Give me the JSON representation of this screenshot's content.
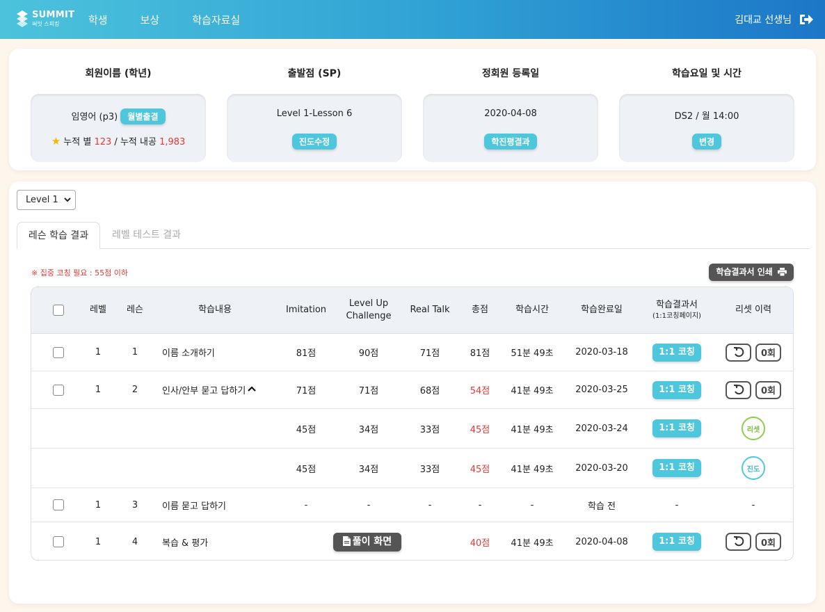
{
  "header": {
    "logo_title": "SUMMIT",
    "logo_sub": "써밋 스피킹",
    "nav": [
      "학생",
      "보상",
      "학습자료실"
    ],
    "user_name": "김대교 선생님"
  },
  "info": {
    "member": {
      "title": "회원이름 (학년)",
      "name": "임영어 (p3)",
      "button": "월별출결",
      "stars_label": "누적 별",
      "stars": "123",
      "sep": "/",
      "points_label": "누적 내공",
      "points": "1,983"
    },
    "start": {
      "title": "출발점 (SP)",
      "value": "Level 1-Lesson 6",
      "button": "진도수정"
    },
    "regdate": {
      "title": "정회원 등록일",
      "value": "2020-04-08",
      "button": "학진평결과"
    },
    "schedule": {
      "title": "학습요일 및 시간",
      "value": "DS2 / 월 14:00",
      "button": "변경"
    }
  },
  "level_select": {
    "value": "Level 1"
  },
  "tabs": [
    "레슨 학습 결과",
    "레벨 테스트 결과"
  ],
  "note": "※ 집중 코칭 필요 : 55점 이하",
  "print_button": "학습결과서 인쇄",
  "table": {
    "headers": {
      "level": "레벨",
      "lesson": "레슨",
      "content": "학습내용",
      "imitation": "Imitation",
      "levelup1": "Level Up",
      "levelup2": "Challenge",
      "realtalk": "Real Talk",
      "total": "총점",
      "time": "학습시간",
      "date": "학습완료일",
      "report1": "학습결과서",
      "report2": "(1:1코칭페이지)",
      "reset": "리셋 이력"
    },
    "coach_label": "1:1 코칭",
    "rows": [
      {
        "level": "1",
        "lesson": "1",
        "content": "이름 소개하기",
        "imitation": "81점",
        "levelup": "90점",
        "realtalk": "71점",
        "total": "81점",
        "time": "51분 49초",
        "date": "2020-03-18",
        "count": "0회"
      },
      {
        "level": "1",
        "lesson": "2",
        "content": "인사/안부 묻고 답하기",
        "imitation": "71점",
        "levelup": "71점",
        "realtalk": "68점",
        "total": "54점",
        "time": "41분 49초",
        "date": "2020-03-25",
        "count": "0회"
      },
      {
        "imitation": "45점",
        "levelup": "34점",
        "realtalk": "33점",
        "total": "45점",
        "time": "41분 49초",
        "date": "2020-03-24",
        "status": "리셋"
      },
      {
        "imitation": "45점",
        "levelup": "34점",
        "realtalk": "33점",
        "total": "45점",
        "time": "41분 49초",
        "date": "2020-03-20",
        "status": "진도"
      },
      {
        "level": "1",
        "lesson": "3",
        "content": "이름 묻고 답하기",
        "imitation": "-",
        "levelup": "-",
        "realtalk": "-",
        "total": "-",
        "time": "-",
        "date": "학습 전",
        "report": "-",
        "reset": "-"
      },
      {
        "level": "1",
        "lesson": "4",
        "content": "복습 & 평가",
        "solve": "풀이 화면",
        "total": "40점",
        "time": "41분 49초",
        "date": "2020-04-08",
        "count": "0회"
      }
    ]
  },
  "colors": {
    "accent": "#4ec7dd",
    "alert": "#e53935",
    "dark_button": "#555555"
  }
}
